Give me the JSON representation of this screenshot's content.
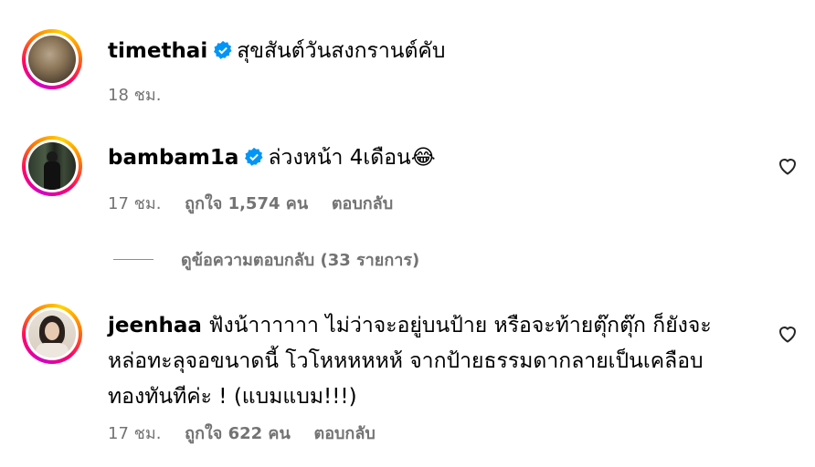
{
  "comments": [
    {
      "username": "timethai",
      "verified": true,
      "text": "สุขสันต์วันสงกรานต์คับ",
      "time": "18 ชม.",
      "likes": "",
      "reply_label": "",
      "avatar": "lion-photo"
    },
    {
      "username": "bambam1a",
      "verified": true,
      "text": "ล่วงหน้า 4เดือน😂",
      "time": "17 ชม.",
      "likes": "ถูกใจ 1,574 คน",
      "reply_label": "ตอบกลับ",
      "avatar": "person-photo"
    },
    {
      "username": "jeenhaa",
      "verified": false,
      "text_lines": [
        "ฟังน้าาาาาา ไม่ว่าจะอยู่บนป้าย หรือจะท้ายตุ๊กตุ๊ก ก็ยังจะ",
        "หล่อทะลุจอขนาดนี้ โวโหหหหหห้ จากป้ายธรรมดากลายเป็นเคลือบ",
        "ทองทันทีค่ะ ! (แบมแบม!!!)"
      ],
      "time": "17 ชม.",
      "likes": "ถูกใจ 622 คน",
      "reply_label": "ตอบกลับ",
      "avatar": "woman-photo"
    }
  ],
  "view_replies": "ดูข้อความตอบกลับ (33 รายการ)",
  "colors": {
    "muted": "#737373",
    "verified": "#0095f6",
    "text": "#000000"
  }
}
